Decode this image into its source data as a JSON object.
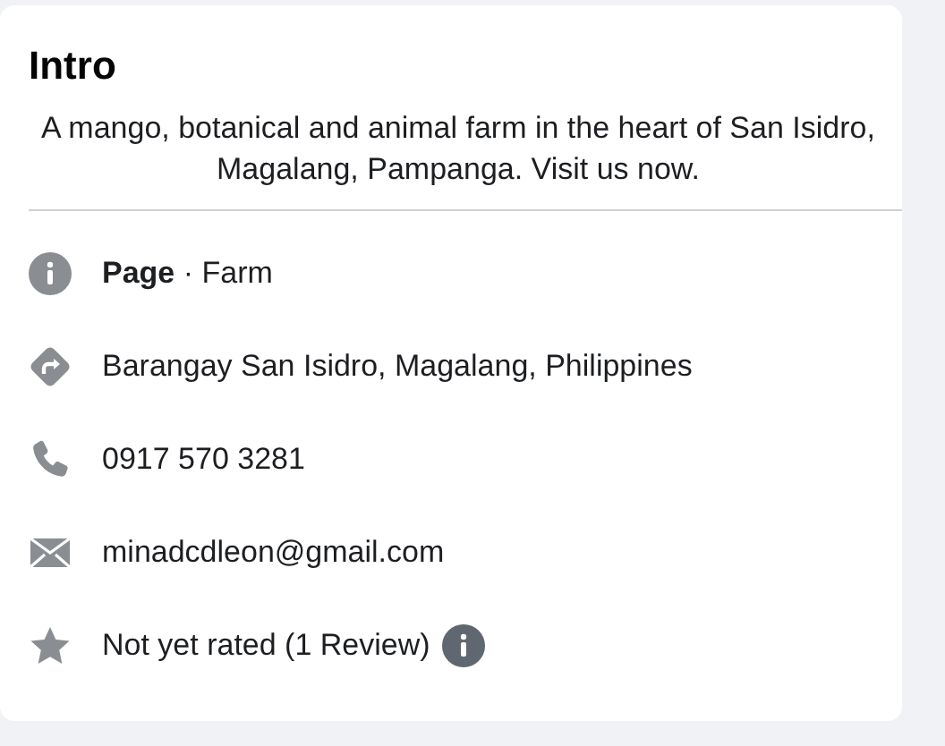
{
  "intro": {
    "title": "Intro",
    "bio": "A mango, botanical and animal farm in the heart of San Isidro, Magalang, Pampanga. Visit us now.",
    "details": [
      {
        "kind": "category",
        "text": "**Page** · Farm"
      },
      {
        "kind": "address",
        "text": "Barangay San Isidro, Magalang, Philippines"
      },
      {
        "kind": "phone",
        "text": "0917 570 3281"
      },
      {
        "kind": "email",
        "text": "minadcdleon@gmail.com"
      },
      {
        "kind": "rating",
        "text": "Not yet rated (1 Review)"
      }
    ]
  }
}
